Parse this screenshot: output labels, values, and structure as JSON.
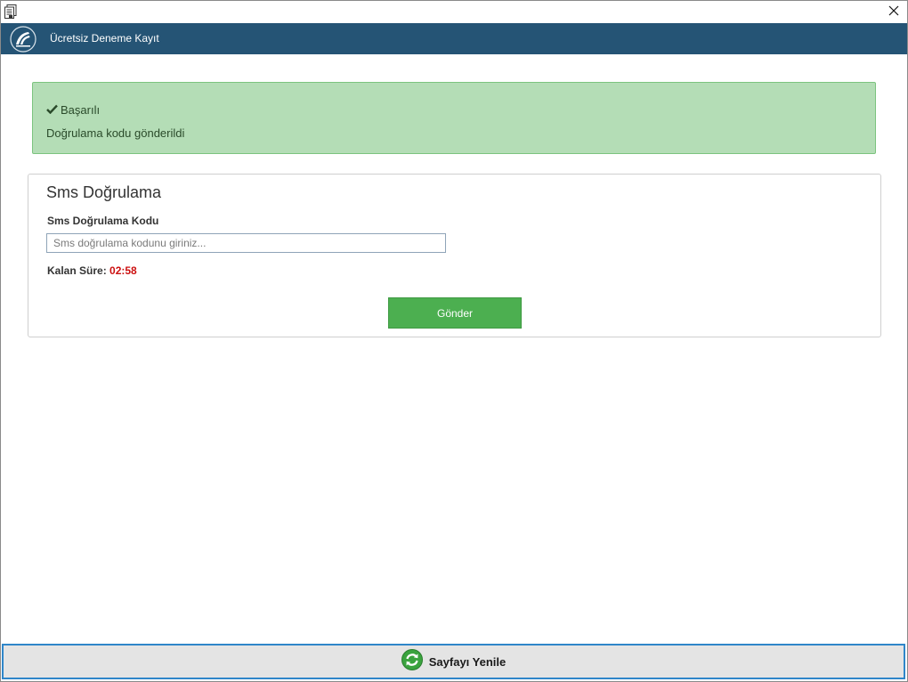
{
  "window": {
    "icons": {
      "app": "document-app-icon",
      "close": "close-icon"
    }
  },
  "header": {
    "title": "Ücretsiz Deneme Kayıt",
    "background": "#255475",
    "logo_icon": "company-logo"
  },
  "alert": {
    "title": "Başarılı",
    "message": "Doğrulama kodu gönderildi",
    "icon": "check-icon",
    "background": "#b4ddb6"
  },
  "sms_panel": {
    "title": "Sms Doğrulama",
    "field_label": "Sms Doğrulama Kodu",
    "input_value": "",
    "input_placeholder": "Sms doğrulama kodunu giriniz...",
    "timer_label": "Kalan Süre:",
    "timer_value": "02:58",
    "timer_color": "#cc1010",
    "submit_label": "Gönder",
    "submit_color": "#4caf50"
  },
  "footer": {
    "refresh_label": "Sayfayı Yenile",
    "refresh_icon": "refresh-icon"
  }
}
